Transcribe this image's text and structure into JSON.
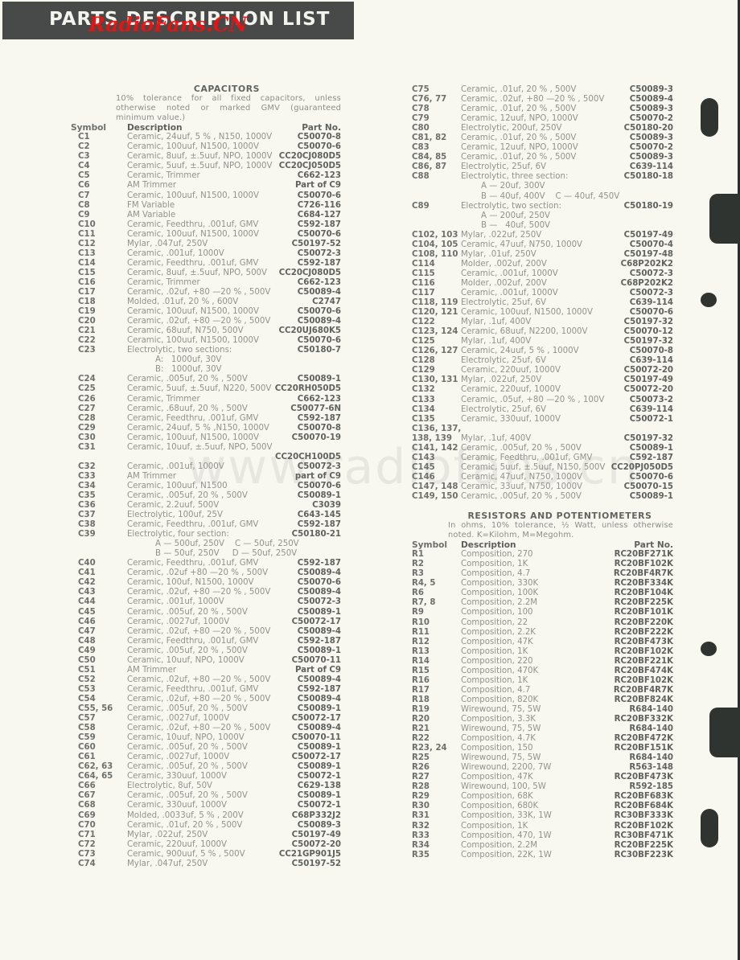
{
  "header": {
    "title": "PARTS DESCRIPTION LIST",
    "watermark": "RadioFans.CN"
  },
  "watermark_center": "www.radiofans.cn",
  "capacitors": {
    "title": "CAPACITORS",
    "note": "10% tolerance for all fixed capacitors, unless otherwise noted or marked GMV (guaranteed minimum value.)",
    "headers": {
      "symbol": "Symbol",
      "description": "Description",
      "part": "Part No."
    },
    "left_rows": [
      {
        "s": "C1",
        "d": "Ceramic, 24uuf, 5 % , N150, 1000V",
        "p": "C50070-8"
      },
      {
        "s": "C2",
        "d": "Ceramic, 100uuf, N1500, 1000V",
        "p": "C50070-6"
      },
      {
        "s": "C3",
        "d": "Ceramic, 8uuf, ±.5uuf, NPO, 1000V",
        "p": "CC20CJ080D5"
      },
      {
        "s": "C4",
        "d": "Ceramic, 5uuf, ±.5uuf, NPO, 1000V",
        "p": "CC20CJ050D5"
      },
      {
        "s": "C5",
        "d": "Ceramic, Trimmer",
        "p": "C662-123"
      },
      {
        "s": "C6",
        "d": "AM Trimmer",
        "p": "Part of C9"
      },
      {
        "s": "C7",
        "d": "Ceramic, 100uuf, N1500, 1000V",
        "p": "C50070-6"
      },
      {
        "s": "C8",
        "d": "FM Variable",
        "p": "C726-116"
      },
      {
        "s": "C9",
        "d": "AM Variable",
        "p": "C684-127"
      },
      {
        "s": "C10",
        "d": "Ceramic, Feedthru, .001uf, GMV",
        "p": "C592-187"
      },
      {
        "s": "C11",
        "d": "Ceramic, 100uuf, N1500, 1000V",
        "p": "C50070-6"
      },
      {
        "s": "C12",
        "d": "Mylar, .047uf, 250V",
        "p": "C50197-52"
      },
      {
        "s": "C13",
        "d": "Ceramic, .001uf, 1000V",
        "p": "C50072-3"
      },
      {
        "s": "C14",
        "d": "Ceramic, Feedthru, .001uf, GMV",
        "p": "C592-187"
      },
      {
        "s": "C15",
        "d": "Ceramic, 8uuf, ±.5uuf, NPO, 500V",
        "p": "CC20CJ080D5"
      },
      {
        "s": "C16",
        "d": "Ceramic, Trimmer",
        "p": "C662-123"
      },
      {
        "s": "C17",
        "d": "Ceramic, .02uf, +80 —20 % , 500V",
        "p": "C50089-4"
      },
      {
        "s": "C18",
        "d": "Molded, .01uf, 20 % , 600V",
        "p": "C2747"
      },
      {
        "s": "C19",
        "d": "Ceramic, 100uuf, N1500, 1000V",
        "p": "C50070-6"
      },
      {
        "s": "C20",
        "d": "Ceramic, .02uf, +80 —20 % , 500V",
        "p": "C50089-4"
      },
      {
        "s": "C21",
        "d": "Ceramic, 68uuf, N750, 500V",
        "p": "CC20UJ680K5"
      },
      {
        "s": "C22",
        "d": "Ceramic, 100uuf, N1500, 1000V",
        "p": "C50070-6"
      },
      {
        "s": "C23",
        "d": "Electrolytic, two sections:",
        "p": "C50180-7",
        "sub": [
          "A:   1000uf, 30V",
          "B:   1000uf, 30V"
        ]
      },
      {
        "s": "C24",
        "d": "Ceramic, .005uf, 20 % , 500V",
        "p": "C50089-1"
      },
      {
        "s": "C25",
        "d": "Ceramic, 5uuf, ±.5uuf, N220, 500V",
        "p": "CC20RH050D5"
      },
      {
        "s": "C26",
        "d": "Ceramic, Trimmer",
        "p": "C662-123"
      },
      {
        "s": "C27",
        "d": "Ceramic, .68uuf, 20 % , 500V",
        "p": "C50077-6N"
      },
      {
        "s": "C28",
        "d": "Ceramic, Feedthru, .001uf, GMV",
        "p": "C592-187"
      },
      {
        "s": "C29",
        "d": "Ceramic, 24uuf, 5 % ,N150, 1000V",
        "p": "C50070-8"
      },
      {
        "s": "C30",
        "d": "Ceramic, 100uuf, N1500, 1000V",
        "p": "C50070-19"
      },
      {
        "s": "C31",
        "d": "Ceramic, 10uuf, ±.5uuf, NPO, 500V",
        "p": "",
        "part_next_line": "CC20CH100D5"
      },
      {
        "s": "C32",
        "d": "Ceramic, .001uf, 1000V",
        "p": "C50072-3"
      },
      {
        "s": "C33",
        "d": "AM Trimmer",
        "p": "part of C9"
      },
      {
        "s": "C34",
        "d": "Ceramic, 100uuf, N1500",
        "p": "C50070-6"
      },
      {
        "s": "C35",
        "d": "Ceramic, .005uf, 20 % , 500V",
        "p": "C50089-1"
      },
      {
        "s": "C36",
        "d": "Ceramic, 2.2uuf, 500V",
        "p": "C3039"
      },
      {
        "s": "C37",
        "d": "Electrolytic, 100uf, 25V",
        "p": "C643-145"
      },
      {
        "s": "C38",
        "d": "Ceramic, Feedthru, .001uf, GMV",
        "p": "C592-187"
      },
      {
        "s": "C39",
        "d": "Electrolytic, four section:",
        "p": "C50180-21",
        "sub": [
          "A — 500uf, 250V    C — 50uf, 250V",
          "B — 50uf, 250V     D — 50uf, 250V"
        ]
      },
      {
        "s": "C40",
        "d": "Ceramic, Feedthru, .001uf, GMV",
        "p": "C592-187"
      },
      {
        "s": "C41",
        "d": "Ceramic, .02uf +80 —20 % , 500V",
        "p": "C50089-4"
      },
      {
        "s": "C42",
        "d": "Ceramic, 100uf, N1500, 1000V",
        "p": "C50070-6"
      },
      {
        "s": "C43",
        "d": "Ceramic, .02uf, +80 —20 % , 500V",
        "p": "C50089-4"
      },
      {
        "s": "C44",
        "d": "Ceramic, .001uf, 1000V",
        "p": "C50072-3"
      },
      {
        "s": "C45",
        "d": "Ceramic, .005uf, 20 % , 500V",
        "p": "C50089-1"
      },
      {
        "s": "C46",
        "d": "Ceramic, .0027uf, 1000V",
        "p": "C50072-17"
      },
      {
        "s": "C47",
        "d": "Ceramic, .02uf, +80 —20 % , 500V",
        "p": "C50089-4"
      },
      {
        "s": "C48",
        "d": "Ceramic, Feedthru, .001uf, GMV",
        "p": "C592-187"
      },
      {
        "s": "C49",
        "d": "Ceramic, .005uf, 20 % , 500V",
        "p": "C50089-1"
      },
      {
        "s": "C50",
        "d": "Ceramic, 10uuf, NPO, 1000V",
        "p": "C50070-11"
      },
      {
        "s": "C51",
        "d": "AM Trimmer",
        "p": "Part of C9"
      },
      {
        "s": "C52",
        "d": "Ceramic, .02uf, +80 —20 % , 500V",
        "p": "C50089-4"
      },
      {
        "s": "C53",
        "d": "Ceramic, Feedthru, .001uf, GMV",
        "p": "C592-187"
      },
      {
        "s": "C54",
        "d": "Ceramic, .02uf, +80 —20 % , 500V",
        "p": "C50089-4"
      },
      {
        "s": "C55, 56",
        "d": "Ceramic, .005uf, 20 % , 500V",
        "p": "C50089-1"
      },
      {
        "s": "C57",
        "d": "Ceramic, .0027uf, 1000V",
        "p": "C50072-17"
      },
      {
        "s": "C58",
        "d": "Ceramic, .02uf, +80 —20 % , 500V",
        "p": "C50089-4"
      },
      {
        "s": "C59",
        "d": "Ceramic, 10uuf, NPO, 1000V",
        "p": "C50070-11"
      },
      {
        "s": "C60",
        "d": "Ceramic, .005uf, 20 % , 500V",
        "p": "C50089-1"
      },
      {
        "s": "C61",
        "d": "Ceramic, .0027uf, 1000V",
        "p": "C50072-17"
      },
      {
        "s": "C62, 63",
        "d": "Ceramic, .005uf, 20 % , 500V",
        "p": "C50089-1"
      },
      {
        "s": "C64, 65",
        "d": "Ceramic, 330uuf, 1000V",
        "p": "C50072-1"
      },
      {
        "s": "C66",
        "d": "Electrolytic, 8uf, 50V",
        "p": "C629-138"
      },
      {
        "s": "C67",
        "d": "Ceramic, .005uf, 20 % , 500V",
        "p": "C50089-1"
      },
      {
        "s": "C68",
        "d": "Ceramic, 330uuf, 1000V",
        "p": "C50072-1"
      },
      {
        "s": "C69",
        "d": "Molded, .0033uf, 5 % , 200V",
        "p": "C68P332J2"
      },
      {
        "s": "C70",
        "d": "Ceramic, .01uf, 20 % , 500V",
        "p": "C50089-3"
      },
      {
        "s": "C71",
        "d": "Mylar, .022uf, 250V",
        "p": "C50197-49"
      },
      {
        "s": "C72",
        "d": "Ceramic, 220uuf, 1000V",
        "p": "C50072-20"
      },
      {
        "s": "C73",
        "d": "Ceramic, 900uuf, 5 % , 500V",
        "p": "CC21GP901J5"
      },
      {
        "s": "C74",
        "d": "Mylar, .047uf, 250V",
        "p": "C50197-52"
      }
    ],
    "right_rows": [
      {
        "s": "C75",
        "d": "Ceramic, .01uf, 20 % , 500V",
        "p": "C50089-3"
      },
      {
        "s": "C76, 77",
        "d": "Ceramic, .02uf, +80 —20 % , 500V",
        "p": "C50089-4"
      },
      {
        "s": "C78",
        "d": "Ceramic, .01uf, 20 % , 500V",
        "p": "C50089-3"
      },
      {
        "s": "C79",
        "d": "Ceramic, 12uuf, NPO, 1000V",
        "p": "C50070-2"
      },
      {
        "s": "C80",
        "d": "Electrolytic, 200uf, 250V",
        "p": "C50180-20"
      },
      {
        "s": "C81, 82",
        "d": "Ceramic, .01uf, 20 % , 500V",
        "p": "C50089-3"
      },
      {
        "s": "C83",
        "d": "Ceramic, 12uuf, NPO, 1000V",
        "p": "C50070-2"
      },
      {
        "s": "C84, 85",
        "d": "Ceramic, .01uf, 20 % , 500V",
        "p": "C50089-3"
      },
      {
        "s": "C86, 87",
        "d": "Electrolytic, 25uf, 6V",
        "p": "C639-114"
      },
      {
        "s": "C88",
        "d": "Electrolytic, three section:",
        "p": "C50180-18",
        "sub": [
          "A — 20uf, 300V",
          "B — 40uf, 400V    C — 40uf, 450V"
        ]
      },
      {
        "s": "C89",
        "d": "Electrolytic, two section:",
        "p": "C50180-19",
        "sub": [
          "A — 200uf, 250V",
          "B —   40uf, 500V"
        ]
      },
      {
        "s": "C102, 103",
        "d": "Mylar, .022uf, 250V",
        "p": "C50197-49"
      },
      {
        "s": "C104, 105",
        "d": "Ceramic, 47uuf, N750, 1000V",
        "p": "C50070-4"
      },
      {
        "s": "C108, 110",
        "d": "Mylar, .01uf, 250V",
        "p": "C50197-48"
      },
      {
        "s": "C114",
        "d": "Molder, .002uf, 200V",
        "p": "C68P202K2"
      },
      {
        "s": "C115",
        "d": "Ceramic, .001uf, 1000V",
        "p": "C50072-3"
      },
      {
        "s": "C116",
        "d": "Molder, .002uf, 200V",
        "p": "C68P202K2"
      },
      {
        "s": "C117",
        "d": "Ceramic, .001uf, 1000V",
        "p": "C50072-3"
      },
      {
        "s": "C118, 119",
        "d": "Electrolytic, 25uf, 6V",
        "p": "C639-114"
      },
      {
        "s": "C120, 121",
        "d": "Ceramic, 100uuf, N1500, 1000V",
        "p": "C50070-6"
      },
      {
        "s": "C122",
        "d": "Mylar, .1uf, 400V",
        "p": "C50197-32"
      },
      {
        "s": "C123, 124",
        "d": "Ceramic, 68uuf, N2200, 1000V",
        "p": "C50070-12"
      },
      {
        "s": "C125",
        "d": "Mylar, .1uf, 400V",
        "p": "C50197-32"
      },
      {
        "s": "C126, 127",
        "d": "Ceramic, 24uuf, 5 % , 1000V",
        "p": "C50070-8"
      },
      {
        "s": "C128",
        "d": "Electrolytic, 25uf, 6V",
        "p": "C639-114"
      },
      {
        "s": "C129",
        "d": "Ceramic, 220uuf, 1000V",
        "p": "C50072-20"
      },
      {
        "s": "C130, 131",
        "d": "Mylar, .022uf, 250V",
        "p": "C50197-49"
      },
      {
        "s": "C132",
        "d": "Ceramic, 220uuf, 1000V",
        "p": "C50072-20"
      },
      {
        "s": "C133",
        "d": "Ceramic, .05uf, +80 —20 % , 100V",
        "p": "C50073-2"
      },
      {
        "s": "C134",
        "d": "Electrolytic, 25uf, 6V",
        "p": "C639-114"
      },
      {
        "s": "C135",
        "d": "Ceramic, 330uuf, 1000V",
        "p": "C50072-1"
      },
      {
        "s": "C136, 137,",
        "d": "",
        "p": ""
      },
      {
        "s": "  138, 139",
        "d": "Mylar, .1uf, 400V",
        "p": "C50197-32"
      },
      {
        "s": "C141, 142",
        "d": "Ceramic, .005uf, 20 % , 500V",
        "p": "C50089-1"
      },
      {
        "s": "C143",
        "d": "Ceramic, Feedthru, .001uf, GMV",
        "p": "C592-187"
      },
      {
        "s": "C145",
        "d": "Ceramic, 5uuf, ±.5uuf, N150, 500V",
        "p": "CC20PJ050D5"
      },
      {
        "s": "C146",
        "d": "Ceramic, 47uuf, N750, 1000V",
        "p": "C50070-6"
      },
      {
        "s": "C147, 148",
        "d": "Ceramic, 33uuf, N750, 1000V",
        "p": "C50070-15"
      },
      {
        "s": "C149, 150",
        "d": "Ceramic, .005uf, 20 % , 500V",
        "p": "C50089-1"
      }
    ]
  },
  "resistors": {
    "title": "RESISTORS AND POTENTIOMETERS",
    "note": "In ohms, 10% tolerance, ½ Watt, unless otherwise noted. K=Kilohm, M=Megohm.",
    "headers": {
      "symbol": "Symbol",
      "description": "Description",
      "part": "Part No."
    },
    "rows": [
      {
        "s": "R1",
        "d": "Composition, 270",
        "p": "RC20BF271K"
      },
      {
        "s": "R2",
        "d": "Composition, 1K",
        "p": "RC20BF102K"
      },
      {
        "s": "R3",
        "d": "Composition, 4.7",
        "p": "RC20BF4R7K"
      },
      {
        "s": "R4, 5",
        "d": "Composition, 330K",
        "p": "RC20BF334K"
      },
      {
        "s": "R6",
        "d": "Composition, 100K",
        "p": "RC20BF104K"
      },
      {
        "s": "R7, 8",
        "d": "Composition, 2.2M",
        "p": "RC20BF225K"
      },
      {
        "s": "R9",
        "d": "Composition, 100",
        "p": "RC20BF101K"
      },
      {
        "s": "R10",
        "d": "Composition, 22",
        "p": "RC20BF220K"
      },
      {
        "s": "R11",
        "d": "Composition, 2.2K",
        "p": "RC20BF222K"
      },
      {
        "s": "R12",
        "d": "Composition, 47K",
        "p": "RC20BF473K"
      },
      {
        "s": "R13",
        "d": "Composition, 1K",
        "p": "RC20BF102K"
      },
      {
        "s": "R14",
        "d": "Composition, 220",
        "p": "RC20BF221K"
      },
      {
        "s": "R15",
        "d": "Composition, 470K",
        "p": "RC20BF474K"
      },
      {
        "s": "R16",
        "d": "Composition, 1K",
        "p": "RC20BF102K"
      },
      {
        "s": "R17",
        "d": "Composition, 4.7",
        "p": "RC20BF4R7K"
      },
      {
        "s": "R18",
        "d": "Composition, 820K",
        "p": "RC20BF824K"
      },
      {
        "s": "R19",
        "d": "Wirewound, 75, 5W",
        "p": "R684-140"
      },
      {
        "s": "R20",
        "d": "Composition, 3.3K",
        "p": "RC20BF332K"
      },
      {
        "s": "R21",
        "d": "Wirewound, 75, 5W",
        "p": "R684-140"
      },
      {
        "s": "R22",
        "d": "Composition, 4.7K",
        "p": "RC20BF472K"
      },
      {
        "s": "R23, 24",
        "d": "Composition, 150",
        "p": "RC20BF151K"
      },
      {
        "s": "R25",
        "d": "Wirewound, 75, 5W",
        "p": "R684-140"
      },
      {
        "s": "R26",
        "d": "Wirewound, 2200, 7W",
        "p": "R563-148"
      },
      {
        "s": "R27",
        "d": "Composition, 47K",
        "p": "RC20BF473K"
      },
      {
        "s": "R28",
        "d": "Wirewound, 100, 5W",
        "p": "R592-185"
      },
      {
        "s": "R29",
        "d": "Composition, 68K",
        "p": "RC20BF683K"
      },
      {
        "s": "R30",
        "d": "Composition, 680K",
        "p": "RC20BF684K"
      },
      {
        "s": "R31",
        "d": "Composition, 33K, 1W",
        "p": "RC30BF333K"
      },
      {
        "s": "R32",
        "d": "Composition, 1K",
        "p": "RC20BF102K"
      },
      {
        "s": "R33",
        "d": "Composition, 470, 1W",
        "p": "RC30BF471K"
      },
      {
        "s": "R34",
        "d": "Composition, 2.2M",
        "p": "RC20BF225K"
      },
      {
        "s": "R35",
        "d": "Composition, 22K, 1W",
        "p": "RC30BF223K"
      }
    ]
  }
}
